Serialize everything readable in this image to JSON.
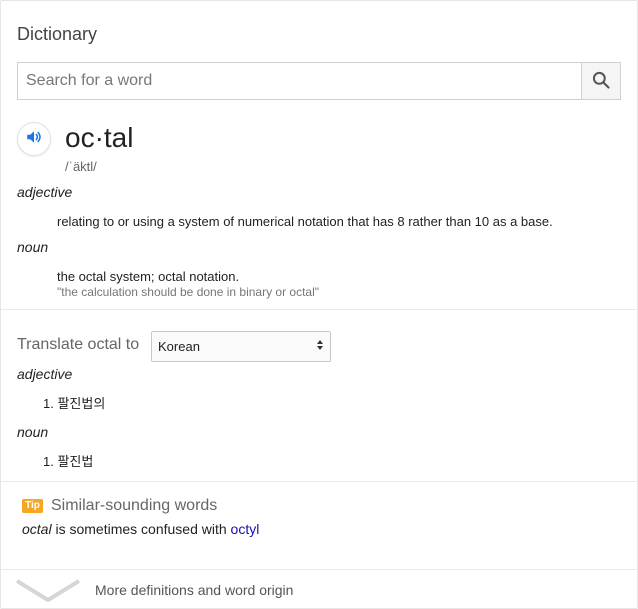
{
  "header": {
    "title": "Dictionary"
  },
  "search": {
    "placeholder": "Search for a word",
    "value": ""
  },
  "entry": {
    "word": "oc·tal",
    "phonetic": "/ˈäktl/",
    "senses": [
      {
        "pos": "adjective",
        "definition": "relating to or using a system of numerical notation that has 8 rather than 10 as a base."
      },
      {
        "pos": "noun",
        "definition": "the octal system; octal notation.",
        "example": "\"the calculation should be done in binary or octal\""
      }
    ]
  },
  "translate": {
    "label": "Translate octal to",
    "selected_language": "Korean",
    "results": [
      {
        "pos": "adjective",
        "items": [
          "1. 팔진법의"
        ]
      },
      {
        "pos": "noun",
        "items": [
          "1. 팔진법"
        ]
      }
    ]
  },
  "tip": {
    "badge": "Tip",
    "title": "Similar-sounding words",
    "word": "octal",
    "connector": " is sometimes confused with ",
    "link_text": "octyl"
  },
  "footer": {
    "more_label": "More definitions and word origin"
  },
  "colors": {
    "accent": "#1a73e8",
    "link": "#1a0dab",
    "tip_badge": "#f5a623"
  },
  "icons": {
    "speaker": "speaker-icon",
    "search": "search-icon",
    "expand": "chevron-down-icon"
  }
}
